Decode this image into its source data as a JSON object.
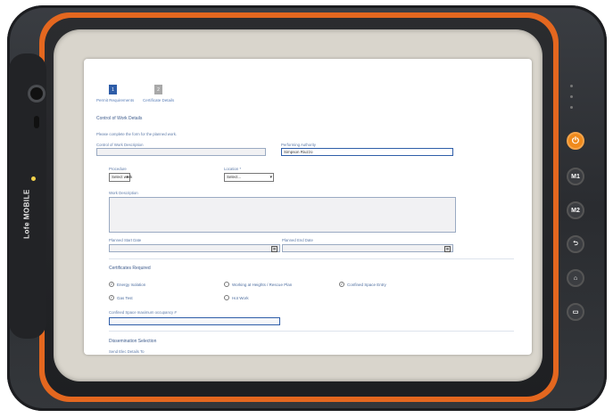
{
  "device": {
    "brand": "Lofe MOBILE",
    "buttons": [
      "⏻",
      "M1",
      "M2",
      "⮌",
      "⌂",
      "▭"
    ],
    "accent_color": "#e4671f"
  },
  "steps": [
    {
      "number": "1",
      "label": "Permit Requirements"
    },
    {
      "number": "2",
      "label": "Certificate Details"
    }
  ],
  "control_of_work": {
    "heading": "Control of Work Details",
    "instruction": "Please complete the form for the planned work.",
    "control_of_work_label": "Control of Work Description",
    "performing_authority_label": "Performing Authority",
    "performing_authority_value": "Simpson Riuzzo",
    "procedure_label": "Procedure",
    "procedure_value": "Select work",
    "location_label": "Location *",
    "location_value": "Select...",
    "work_description_label": "Work Description",
    "planned_start_label": "Planned Start Date",
    "planned_end_label": "Planned End Date"
  },
  "certificates": {
    "heading": "Certificates Required",
    "items": [
      {
        "label": "Energy Isolation",
        "checked": true
      },
      {
        "label": "Working at Heights / Rescue Plan",
        "checked": false
      },
      {
        "label": "Confined Space Entry",
        "checked": true
      },
      {
        "label": "Gas Test",
        "checked": true
      },
      {
        "label": "Hot Work",
        "checked": false
      }
    ],
    "occupancy_label": "Confined Space maximum occupancy #"
  },
  "dissemination": {
    "heading": "Dissemination Selection",
    "sub": "Send Elec Details To"
  }
}
